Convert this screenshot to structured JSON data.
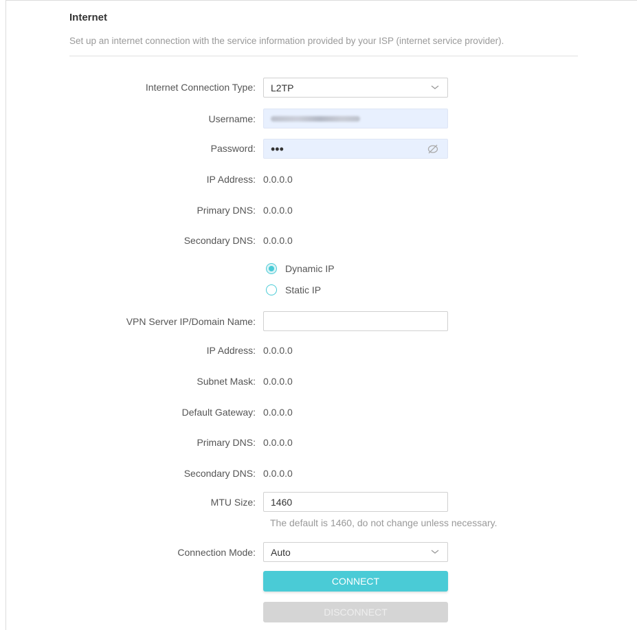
{
  "section": {
    "title": "Internet",
    "description": "Set up an internet connection with the service information provided by your ISP (internet service provider)."
  },
  "form": {
    "connection_type_label": "Internet Connection Type:",
    "connection_type_value": "L2TP",
    "username_label": "Username:",
    "password_label": "Password:",
    "password_value": "•••",
    "ip_address_label": "IP Address:",
    "ip_address_value": "0.0.0.0",
    "primary_dns_label": "Primary DNS:",
    "primary_dns_value": "0.0.0.0",
    "secondary_dns_label": "Secondary DNS:",
    "secondary_dns_value": "0.0.0.0",
    "radio_dynamic_label": "Dynamic IP",
    "radio_static_label": "Static IP",
    "radio_selected": "Dynamic IP",
    "vpn_server_label": "VPN Server IP/Domain Name:",
    "vpn_server_value": "",
    "vpn_ip_address_label": "IP Address:",
    "vpn_ip_address_value": "0.0.0.0",
    "subnet_mask_label": "Subnet Mask:",
    "subnet_mask_value": "0.0.0.0",
    "default_gateway_label": "Default Gateway:",
    "default_gateway_value": "0.0.0.0",
    "vpn_primary_dns_label": "Primary DNS:",
    "vpn_primary_dns_value": "0.0.0.0",
    "vpn_secondary_dns_label": "Secondary DNS:",
    "vpn_secondary_dns_value": "0.0.0.0",
    "mtu_label": "MTU Size:",
    "mtu_value": "1460",
    "mtu_hint": "The default is 1460, do not change unless necessary.",
    "connection_mode_label": "Connection Mode:",
    "connection_mode_value": "Auto"
  },
  "buttons": {
    "connect": "CONNECT",
    "disconnect": "DISCONNECT"
  },
  "icons": {
    "select_chevron": "chevron-down-icon",
    "password_toggle": "eye-off-icon"
  },
  "colors": {
    "accent": "#4acbd6",
    "autofill_bg": "#e8f0fe",
    "disabled_button": "#d5d5d5"
  }
}
